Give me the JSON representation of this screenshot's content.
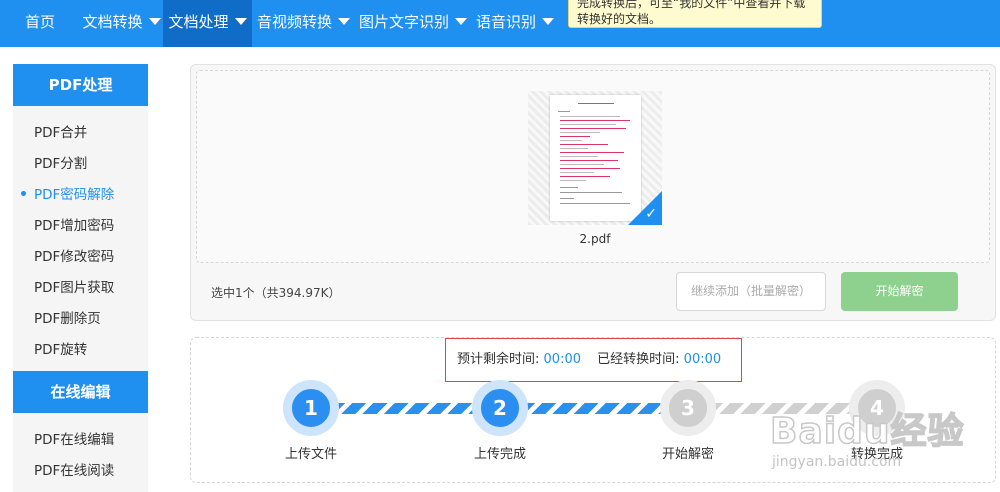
{
  "nav": {
    "items": [
      {
        "label": "首页",
        "dropdown": false,
        "active": false
      },
      {
        "label": "文档转换",
        "dropdown": true,
        "active": false
      },
      {
        "label": "文档处理",
        "dropdown": true,
        "active": true
      },
      {
        "label": "音视频转换",
        "dropdown": true,
        "active": false
      },
      {
        "label": "图片文字识别",
        "dropdown": true,
        "active": false
      },
      {
        "label": "语音识别",
        "dropdown": true,
        "active": false
      }
    ],
    "tooltip_line1": "完成转换后，可至“我的文件”中查看并下载",
    "tooltip_line2": "转换好的文档。"
  },
  "sidebar": {
    "section1_title": "PDF处理",
    "section1_items": [
      "PDF合并",
      "PDF分割",
      "PDF密码解除",
      "PDF增加密码",
      "PDF修改密码",
      "PDF图片获取",
      "PDF删除页",
      "PDF旋转"
    ],
    "active_item": "PDF密码解除",
    "section2_title": "在线编辑",
    "section2_items": [
      "PDF在线编辑",
      "PDF在线阅读"
    ]
  },
  "upload": {
    "file_name": "2.pdf",
    "selection_info": "选中1个（共394.97K）",
    "add_button": "继续添加（批量解密）",
    "start_button": "开始解密"
  },
  "progress": {
    "remaining_label": "预计剩余时间:",
    "remaining_value": "00:00",
    "elapsed_label": "已经转换时间:",
    "elapsed_value": "00:00",
    "steps": [
      {
        "number": "1",
        "label": "上传文件",
        "state": "done"
      },
      {
        "number": "2",
        "label": "上传完成",
        "state": "done"
      },
      {
        "number": "3",
        "label": "开始解密",
        "state": "pending"
      },
      {
        "number": "4",
        "label": "转换完成",
        "state": "pending"
      }
    ]
  },
  "watermark": {
    "logo_text": "Baidu经验",
    "url_text": "jingyan.baidu.com"
  },
  "colors": {
    "brand_blue": "#1f8ff0",
    "active_nav": "#0f6dc8",
    "start_green": "#8ed18f",
    "highlight_red": "#e04444"
  }
}
